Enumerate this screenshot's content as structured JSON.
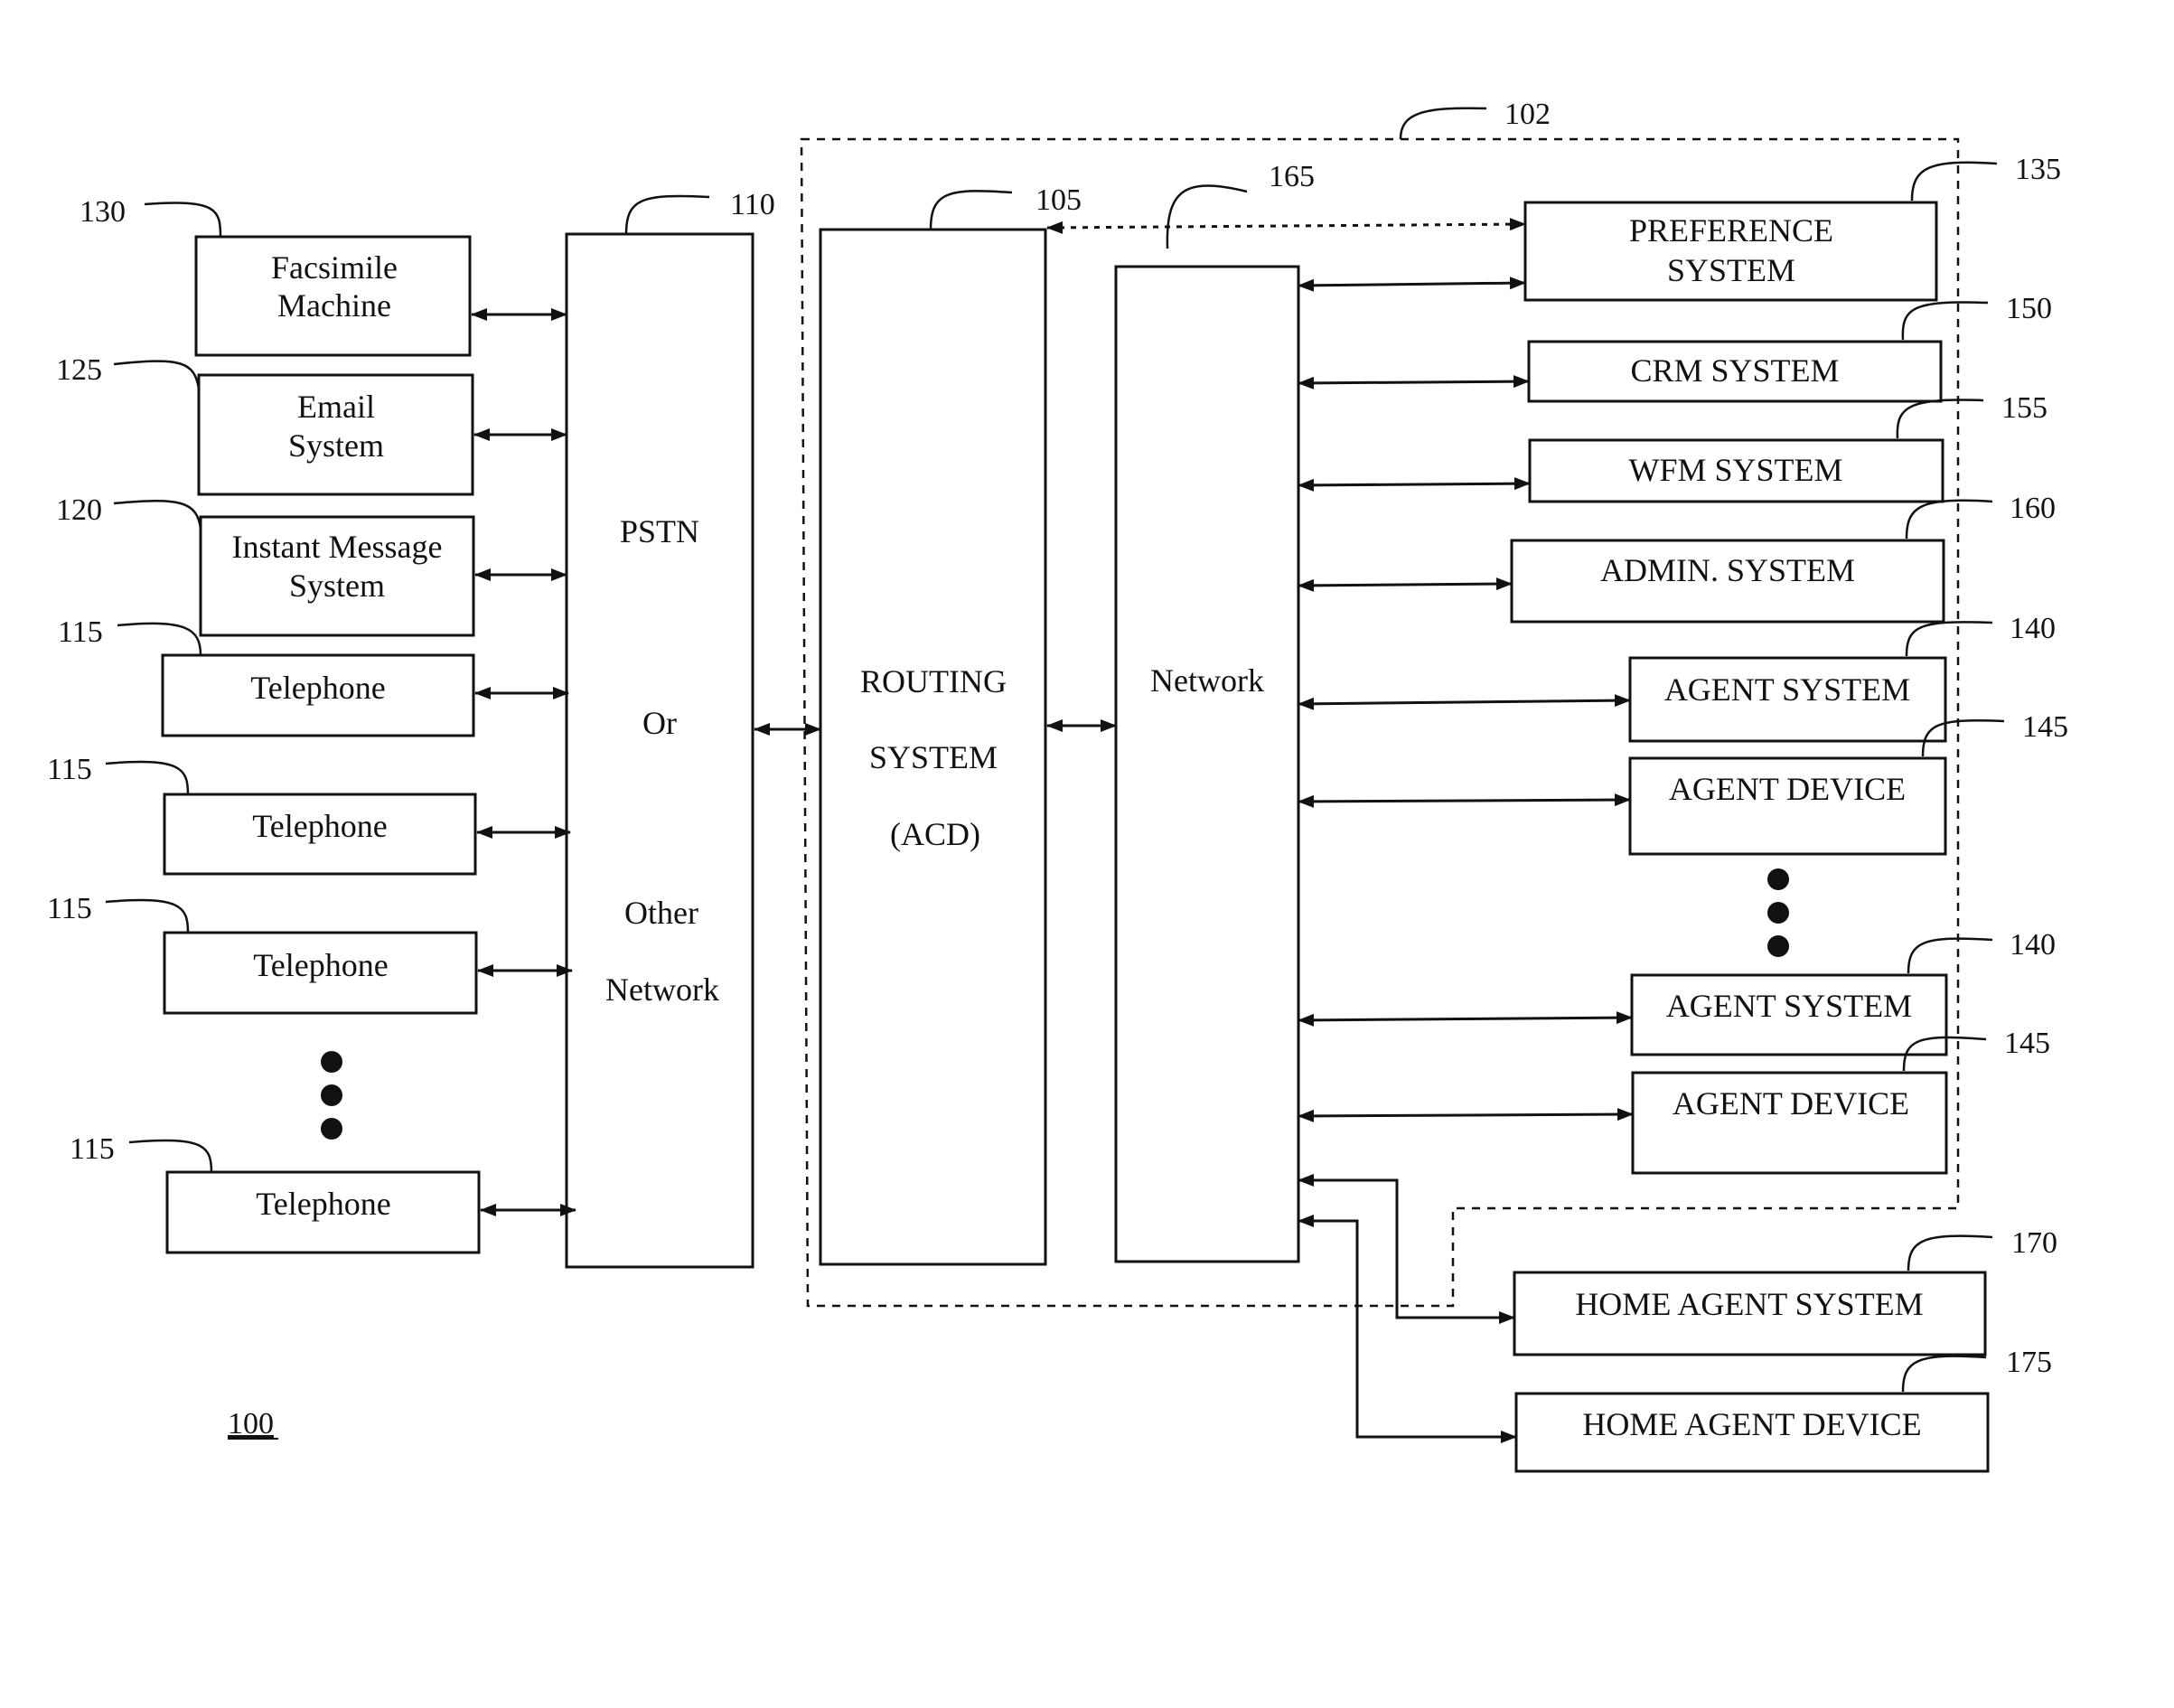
{
  "figure": {
    "number": "100",
    "boundary_ref": "102"
  },
  "left_nodes": [
    {
      "id": "fax",
      "ref": "130",
      "lines": [
        "Facsimile",
        "Machine"
      ]
    },
    {
      "id": "email",
      "ref": "125",
      "lines": [
        "Email",
        "System"
      ]
    },
    {
      "id": "im",
      "ref": "120",
      "lines": [
        "Instant Message",
        "System"
      ]
    },
    {
      "id": "tel1",
      "ref": "115",
      "lines": [
        "Telephone"
      ]
    },
    {
      "id": "tel2",
      "ref": "115",
      "lines": [
        "Telephone"
      ]
    },
    {
      "id": "tel3",
      "ref": "115",
      "lines": [
        "Telephone"
      ]
    },
    {
      "id": "tel4",
      "ref": "115",
      "lines": [
        "Telephone"
      ]
    }
  ],
  "pstn": {
    "ref": "110",
    "lines": [
      "PSTN",
      "Or",
      "Other",
      "Network"
    ]
  },
  "routing": {
    "ref": "105",
    "lines": [
      "ROUTING",
      "SYSTEM",
      "(ACD)"
    ]
  },
  "network": {
    "ref": "165",
    "lines": [
      "Network"
    ]
  },
  "right_nodes": [
    {
      "id": "preference",
      "ref": "135",
      "lines": [
        "PREFERENCE",
        "SYSTEM"
      ]
    },
    {
      "id": "crm",
      "ref": "150",
      "lines": [
        "CRM SYSTEM"
      ]
    },
    {
      "id": "wfm",
      "ref": "155",
      "lines": [
        "WFM  SYSTEM"
      ]
    },
    {
      "id": "admin",
      "ref": "160",
      "lines": [
        "ADMIN. SYSTEM"
      ]
    },
    {
      "id": "agent-system-1",
      "ref": "140",
      "lines": [
        "AGENT SYSTEM"
      ]
    },
    {
      "id": "agent-device-1",
      "ref": "145",
      "lines": [
        "AGENT DEVICE"
      ]
    },
    {
      "id": "agent-system-2",
      "ref": "140",
      "lines": [
        "AGENT SYSTEM"
      ]
    },
    {
      "id": "agent-device-2",
      "ref": "145",
      "lines": [
        "AGENT DEVICE"
      ]
    },
    {
      "id": "home-agent-system",
      "ref": "170",
      "lines": [
        "HOME AGENT SYSTEM"
      ]
    },
    {
      "id": "home-agent-device",
      "ref": "175",
      "lines": [
        "HOME AGENT DEVICE"
      ]
    }
  ],
  "connections": [
    {
      "from": "fax",
      "to": "pstn",
      "type": "bidirectional"
    },
    {
      "from": "email",
      "to": "pstn",
      "type": "bidirectional"
    },
    {
      "from": "im",
      "to": "pstn",
      "type": "bidirectional"
    },
    {
      "from": "tel1",
      "to": "pstn",
      "type": "bidirectional"
    },
    {
      "from": "tel2",
      "to": "pstn",
      "type": "bidirectional"
    },
    {
      "from": "tel3",
      "to": "pstn",
      "type": "bidirectional"
    },
    {
      "from": "tel4",
      "to": "pstn",
      "type": "bidirectional"
    },
    {
      "from": "pstn",
      "to": "routing",
      "type": "bidirectional"
    },
    {
      "from": "routing",
      "to": "network",
      "type": "bidirectional"
    },
    {
      "from": "routing",
      "to": "preference",
      "type": "bidirectional-dashed"
    },
    {
      "from": "network",
      "to": "preference",
      "type": "bidirectional"
    },
    {
      "from": "network",
      "to": "crm",
      "type": "bidirectional"
    },
    {
      "from": "network",
      "to": "wfm",
      "type": "bidirectional"
    },
    {
      "from": "network",
      "to": "admin",
      "type": "bidirectional"
    },
    {
      "from": "network",
      "to": "agent-system-1",
      "type": "bidirectional"
    },
    {
      "from": "network",
      "to": "agent-device-1",
      "type": "bidirectional"
    },
    {
      "from": "network",
      "to": "agent-system-2",
      "type": "bidirectional"
    },
    {
      "from": "network",
      "to": "agent-device-2",
      "type": "bidirectional"
    },
    {
      "from": "network",
      "to": "home-agent-system",
      "type": "bidirectional"
    },
    {
      "from": "network",
      "to": "home-agent-device",
      "type": "bidirectional"
    }
  ]
}
